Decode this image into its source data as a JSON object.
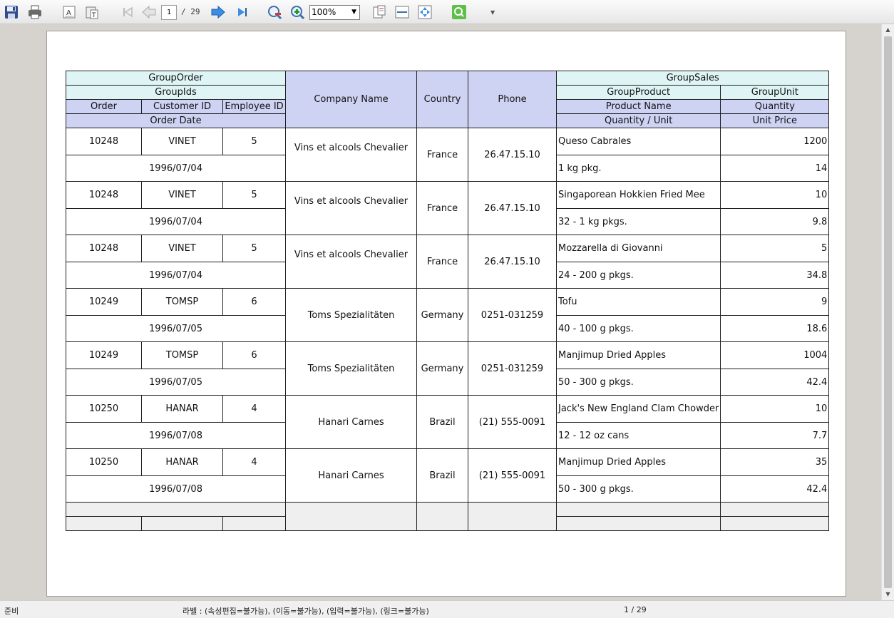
{
  "toolbar": {
    "page_current": "1",
    "page_total": "/ 29",
    "zoom": "100%"
  },
  "table": {
    "h_group_order": "GroupOrder",
    "h_group_ids": "GroupIds",
    "h_order": "Order",
    "h_customer_id": "Customer ID",
    "h_employee_id": "Employee ID",
    "h_order_date": "Order Date",
    "h_company_name": "Company Name",
    "h_country": "Country",
    "h_phone": "Phone",
    "h_group_sales": "GroupSales",
    "h_group_product": "GroupProduct",
    "h_group_unit": "GroupUnit",
    "h_product_name": "Product Name",
    "h_quantity": "Quantity",
    "h_quantity_unit": "Quantity / Unit",
    "h_unit_price": "Unit Price",
    "records": [
      {
        "order": "10248",
        "customer": "VINET",
        "employee": "5",
        "date": "1996/07/04",
        "company": "Vins et alcools Chevalier",
        "country": "France",
        "phone": "26.47.15.10",
        "product": "Queso Cabrales",
        "quantity": "1200",
        "qty_unit": "1 kg pkg.",
        "price": "14"
      },
      {
        "order": "10248",
        "customer": "VINET",
        "employee": "5",
        "date": "1996/07/04",
        "company": "Vins et alcools Chevalier",
        "country": "France",
        "phone": "26.47.15.10",
        "product": "Singaporean Hokkien Fried Mee",
        "quantity": "10",
        "qty_unit": "32 - 1 kg pkgs.",
        "price": "9.8"
      },
      {
        "order": "10248",
        "customer": "VINET",
        "employee": "5",
        "date": "1996/07/04",
        "company": "Vins et alcools Chevalier",
        "country": "France",
        "phone": "26.47.15.10",
        "product": "Mozzarella di Giovanni",
        "quantity": "5",
        "qty_unit": "24 - 200 g pkgs.",
        "price": "34.8"
      },
      {
        "order": "10249",
        "customer": "TOMSP",
        "employee": "6",
        "date": "1996/07/05",
        "company": "Toms Spezialitäten",
        "country": "Germany",
        "phone": "0251-031259",
        "product": "Tofu",
        "quantity": "9",
        "qty_unit": "40 - 100 g pkgs.",
        "price": "18.6"
      },
      {
        "order": "10249",
        "customer": "TOMSP",
        "employee": "6",
        "date": "1996/07/05",
        "company": "Toms Spezialitäten",
        "country": "Germany",
        "phone": "0251-031259",
        "product": "Manjimup Dried Apples",
        "quantity": "1004",
        "qty_unit": "50 - 300 g pkgs.",
        "price": "42.4"
      },
      {
        "order": "10250",
        "customer": "HANAR",
        "employee": "4",
        "date": "1996/07/08",
        "company": "Hanari Carnes",
        "country": "Brazil",
        "phone": "(21) 555-0091",
        "product": "Jack's New England Clam Chowder",
        "quantity": "10",
        "qty_unit": "12 - 12 oz cans",
        "price": "7.7"
      },
      {
        "order": "10250",
        "customer": "HANAR",
        "employee": "4",
        "date": "1996/07/08",
        "company": "Hanari Carnes",
        "country": "Brazil",
        "phone": "(21) 555-0091",
        "product": "Manjimup Dried Apples",
        "quantity": "35",
        "qty_unit": "50 - 300 g pkgs.",
        "price": "42.4"
      }
    ]
  },
  "status": {
    "left": "준비",
    "middle": "라벨 : (속성편집=불가능), (이동=불가능), (입력=불가능), (링크=불가능)",
    "page": "1 / 29"
  }
}
